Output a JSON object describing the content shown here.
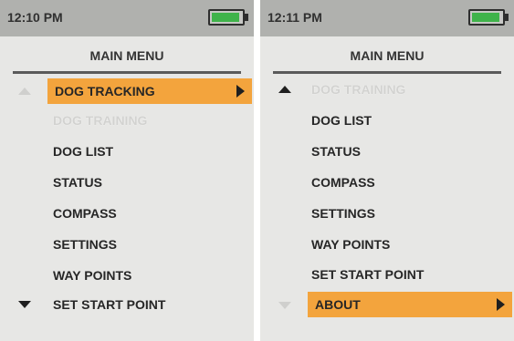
{
  "left_screen": {
    "time": "12:10 PM",
    "title": "MAIN MENU",
    "items": [
      {
        "label": "DOG TRACKING",
        "state": "selected"
      },
      {
        "label": "DOG TRAINING",
        "state": "disabled"
      },
      {
        "label": "DOG LIST",
        "state": "normal"
      },
      {
        "label": "STATUS",
        "state": "normal"
      },
      {
        "label": "COMPASS",
        "state": "normal"
      },
      {
        "label": "SETTINGS",
        "state": "normal"
      },
      {
        "label": "WAY POINTS",
        "state": "normal"
      },
      {
        "label": "SET START POINT",
        "state": "normal"
      }
    ],
    "scroll_up": "disabled",
    "scroll_down": "enabled"
  },
  "right_screen": {
    "time": "12:11 PM",
    "title": "MAIN MENU",
    "items": [
      {
        "label": "DOG TRAINING",
        "state": "disabled"
      },
      {
        "label": "DOG LIST",
        "state": "normal"
      },
      {
        "label": "STATUS",
        "state": "normal"
      },
      {
        "label": "COMPASS",
        "state": "normal"
      },
      {
        "label": "SETTINGS",
        "state": "normal"
      },
      {
        "label": "WAY POINTS",
        "state": "normal"
      },
      {
        "label": "SET START POINT",
        "state": "normal"
      },
      {
        "label": "ABOUT",
        "state": "selected"
      }
    ],
    "scroll_up": "enabled",
    "scroll_down": "disabled"
  },
  "colors": {
    "status_bar": "#b0b1ae",
    "screen_bg": "#e7e7e5",
    "highlight": "#f3a43d",
    "battery_green": "#3fb34a"
  },
  "icons": {
    "battery": "battery-icon",
    "scroll_up": "triangle-up-icon",
    "scroll_down": "triangle-down-icon",
    "submenu": "caret-right-icon"
  }
}
